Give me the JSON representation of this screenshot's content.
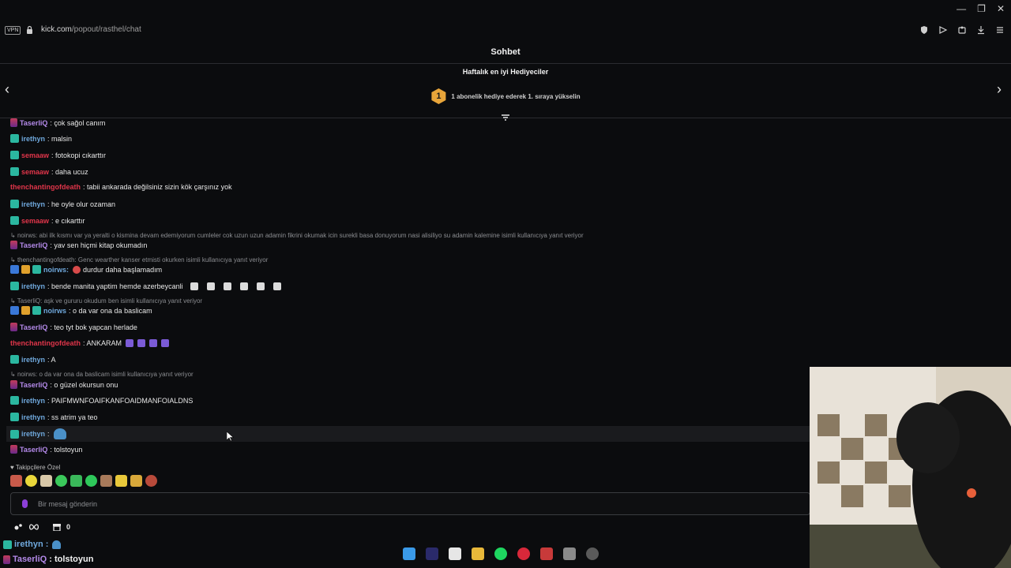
{
  "browser": {
    "vpn_label": "VPN",
    "url_host": "kick.com",
    "url_path": "/popout/rasthel/chat"
  },
  "header": {
    "title": "Sohbet",
    "gifters_title": "Haftalık en iyi Hediyeciler",
    "rank_number": "1",
    "rank_text": "1 abonelik hediye ederek 1. sıraya yükselin"
  },
  "messages": [
    {
      "user": "TaserliQ",
      "text": ": çok sağol canım"
    },
    {
      "user": "irethyn",
      "text": ": malsin"
    },
    {
      "user": "semaaw",
      "text": ": fotokopi cıkarttır"
    },
    {
      "user": "semaaw",
      "text": ": daha ucuz"
    },
    {
      "user": "thenchantingofdeath",
      "text": ": tabii ankarada değilsiniz sizin kök çarşınız yok"
    },
    {
      "user": "irethyn",
      "text": ": he oyle olur ozaman"
    },
    {
      "user": "semaaw",
      "text": ": e cıkarttır"
    },
    {
      "reply": "noirws: abi ilk kısmı var ya yeralti o kismina devam edemiyorum cumleler cok uzun uzun adamin fikrini okumak icin surekli basa donuyorum nasi alisiliyo su adamin kalemine isimli kullanıcıya yanıt veriyor"
    },
    {
      "user": "TaserliQ",
      "text": ": yav sen hiçmi kitap okumadın"
    },
    {
      "reply": "thenchantingofdeath: Genc wearther kanser etmisti okurken isimli kullanıcıya yanıt veriyor"
    },
    {
      "user": "noirws",
      "text": "durdur daha başlamadım"
    },
    {
      "user": "irethyn",
      "text": ": bende manita yaptim hemde azerbeycanli"
    },
    {
      "reply": "TaserliQ: aşk ve gururu okudum ben isimli kullanıcıya yanıt veriyor"
    },
    {
      "user": "noirws",
      "text": ": o da var ona da baslicam"
    },
    {
      "user": "TaserliQ",
      "text": ": teo tyt bok yapcan herlade"
    },
    {
      "user": "thenchantingofdeath",
      "text": ": ANKARAM"
    },
    {
      "user": "irethyn",
      "text": ": A"
    },
    {
      "reply": "noirws: o da var ona da baslicam isimli kullanıcıya yanıt veriyor"
    },
    {
      "user": "TaserliQ",
      "text": ": o güzel okursun onu"
    },
    {
      "user": "irethyn",
      "text": ": PAIFMWNFOAIFKANFOAIDMANFOIALDNS"
    },
    {
      "user": "irethyn",
      "text": ": ss atrim ya teo"
    },
    {
      "user": "irethyn",
      "text": ":"
    },
    {
      "user": "TaserliQ",
      "text": ": tolstoyun"
    }
  ],
  "noirws_colon": "noirws:",
  "followers_only_label": "Takipçilere Özel",
  "input": {
    "placeholder": "Bir mesaj gönderin"
  },
  "bottom": {
    "count": "0"
  },
  "overlay": [
    {
      "user": "irethyn",
      "text": ":"
    },
    {
      "user": "TaserliQ",
      "text": ": tolstoyun"
    }
  ],
  "colors": {
    "accent": "#8c3fd8",
    "gold": "#e8a53a",
    "blue_user": "#6fa8dc",
    "red_user": "#e0354a",
    "purple_user": "#b48aea"
  }
}
